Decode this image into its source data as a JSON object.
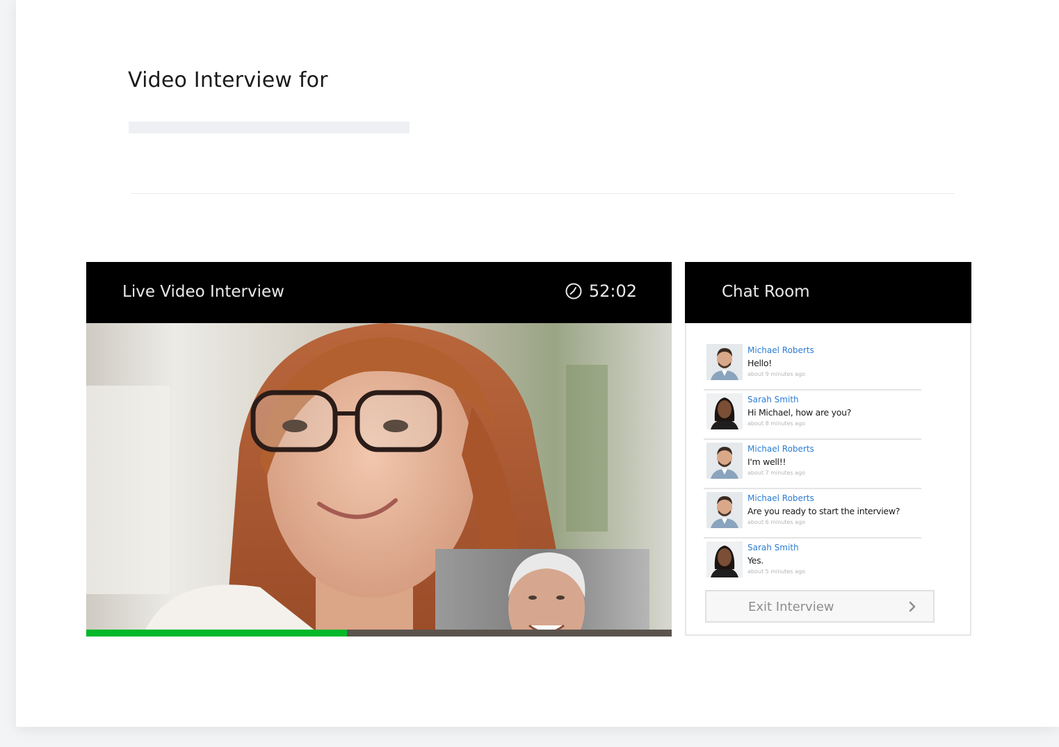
{
  "page": {
    "title": "Video Interview for"
  },
  "video": {
    "header_title": "Live Video Interview",
    "timer": "52:02",
    "timer_icon": "clock-icon",
    "progress_fraction": 0.445,
    "progress_color": "#04b82a"
  },
  "chat": {
    "header_title": "Chat Room",
    "messages": [
      {
        "name": "Michael Roberts",
        "text": "Hello!",
        "time": "about 9 minutes ago",
        "avatar": "man"
      },
      {
        "name": "Sarah Smith",
        "text": "Hi Michael, how are you?",
        "time": "about 8 minutes ago",
        "avatar": "woman"
      },
      {
        "name": "Michael Roberts",
        "text": "I'm well!!",
        "time": "about 7 minutes ago",
        "avatar": "man"
      },
      {
        "name": "Michael Roberts",
        "text": "Are you ready to start the interview?",
        "time": "about 6 minutes ago",
        "avatar": "man"
      },
      {
        "name": "Sarah Smith",
        "text": "Yes.",
        "time": "about 5 minutes ago",
        "avatar": "woman"
      }
    ],
    "exit_label": "Exit Interview",
    "exit_icon": "chevron-right-icon",
    "name_color": "#2b7cd3"
  }
}
